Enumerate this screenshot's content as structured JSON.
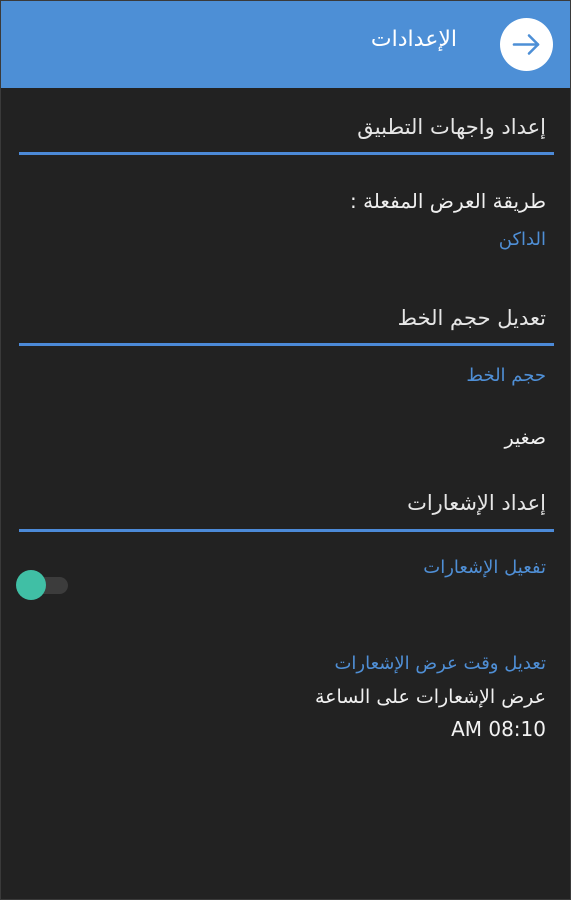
{
  "appbar": {
    "title": "الإعدادات",
    "back_icon": "arrow-right-icon"
  },
  "interface_section": {
    "title": "إعداد واجهات التطبيق",
    "display_mode_label": "طريقة العرض المفعلة :",
    "display_mode_value": "الداكن"
  },
  "font_section": {
    "title": "تعديل حجم الخط",
    "font_size_label": "حجم الخط",
    "font_size_value": "صغير"
  },
  "notifications_section": {
    "title": "إعداد الإشعارات",
    "enable_label": "تفعيل الإشعارات",
    "enable_on": true,
    "time_setting_label": "تعديل وقت عرض الإشعارات",
    "time_description": "عرض الإشعارات على الساعة",
    "time_value": "AM 08:10"
  },
  "colors": {
    "appbar": "#4d8fd6",
    "accent_link": "#4f8fd6",
    "divider": "#4c8ad8",
    "toggle_thumb": "#40bfa5",
    "background": "#222222"
  }
}
